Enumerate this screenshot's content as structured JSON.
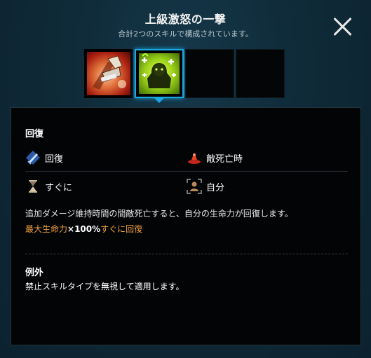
{
  "header": {
    "title": "上級激怒の一撃",
    "subtitle": "合計2つのスキルで構成されています。"
  },
  "skill_slots": [
    {
      "icon": "rage-strike-skill-icon",
      "state": "filled"
    },
    {
      "icon": "green-heal-skill-icon",
      "state": "selected"
    },
    {
      "icon": "",
      "state": "empty"
    },
    {
      "icon": "",
      "state": "empty"
    }
  ],
  "details": {
    "section_title": "回復",
    "attributes": {
      "type_label": "回復",
      "trigger_label": "敵死亡時",
      "timing_label": "すぐに",
      "target_label": "自分"
    },
    "description": "追加ダメージ維持時間の間敵死亡すると、自分の生命力が回復します。",
    "effect": {
      "prefix": "最大生命力",
      "value": "×100%",
      "suffix": "すぐに回復"
    },
    "exception_title": "例外",
    "exception_text": "禁止スキルタイプを無視して適用します。"
  },
  "colors": {
    "accent": "#1ba8e0",
    "effect_text": "#f0a040",
    "background": "#0f2a38"
  }
}
